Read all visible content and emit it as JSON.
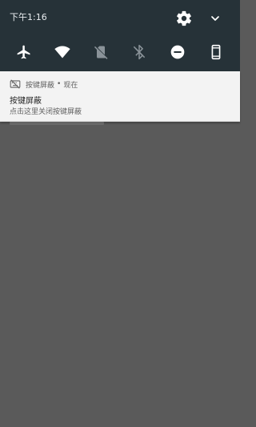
{
  "status_bar": {
    "time": "下午1:16"
  },
  "quick_settings": {
    "tiles": [
      {
        "name": "airplane-mode",
        "icon": "airplane-icon",
        "active": true
      },
      {
        "name": "wifi",
        "icon": "wifi-icon",
        "active": true
      },
      {
        "name": "sim",
        "icon": "no-sim-icon",
        "active": false
      },
      {
        "name": "bluetooth",
        "icon": "bluetooth-off-icon",
        "active": false
      },
      {
        "name": "do-not-disturb",
        "icon": "dnd-icon",
        "active": true
      },
      {
        "name": "rotation",
        "icon": "phone-portrait-icon",
        "active": true
      }
    ]
  },
  "notification": {
    "app_name": "按键屏蔽",
    "separator": "•",
    "time": "现在",
    "title": "按键屏蔽",
    "text": "点击这里关闭按键屏蔽"
  },
  "colors": {
    "shade_bg": "#263238",
    "notification_bg": "#f3f3f3",
    "scrim": "#5a5a5a"
  }
}
